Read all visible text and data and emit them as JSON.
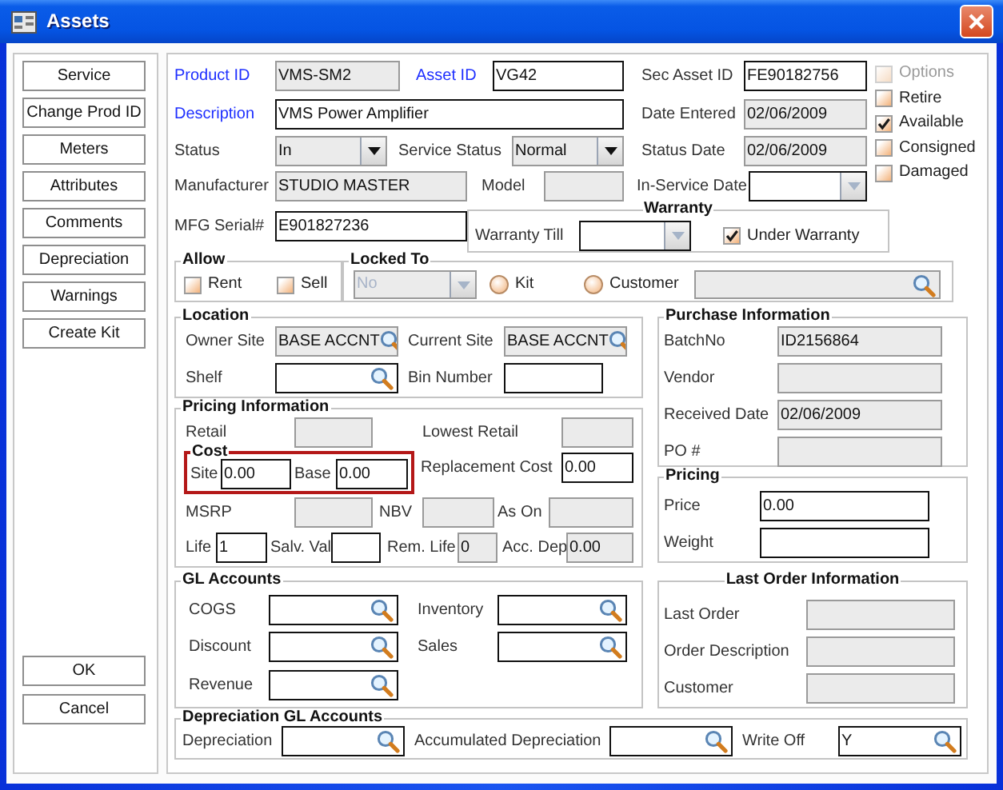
{
  "window": {
    "title": "Assets"
  },
  "side_buttons": [
    "Service",
    "Change Prod ID",
    "Meters",
    "Attributes",
    "Comments",
    "Depreciation",
    "Warnings",
    "Create Kit"
  ],
  "dialog_buttons": [
    "OK",
    "Cancel"
  ],
  "header": {
    "fields": [
      {
        "label": "Product ID",
        "link": true,
        "kind": "readonly",
        "value": "VMS-SM2"
      },
      {
        "label": "Asset ID",
        "link": true,
        "kind": "input",
        "value": "VG42"
      },
      {
        "label": "Sec Asset ID",
        "link": false,
        "kind": "input",
        "value": "FE90182756"
      },
      {
        "label": "Description",
        "link": true,
        "kind": "input",
        "value": "VMS Power Amplifier"
      },
      {
        "label": "Date Entered",
        "link": false,
        "kind": "readonly",
        "value": "02/06/2009"
      },
      {
        "label": "Status",
        "link": false,
        "kind": "combo",
        "value": "In"
      },
      {
        "label": "Service Status",
        "link": false,
        "kind": "combo",
        "value": "Normal"
      },
      {
        "label": "Status Date",
        "link": false,
        "kind": "readonly",
        "value": "02/06/2009"
      },
      {
        "label": "Manufacturer",
        "link": false,
        "kind": "readonly",
        "value": "STUDIO MASTER"
      },
      {
        "label": "Model",
        "link": false,
        "kind": "readonly"
      },
      {
        "label": "In-Service Date",
        "link": false,
        "kind": "date-picker"
      },
      {
        "label": "MFG Serial#",
        "link": false,
        "kind": "input",
        "value": "E901827236"
      }
    ],
    "options": [
      {
        "label": "Options",
        "checked": false,
        "disabled": true
      },
      {
        "label": "Retire",
        "checked": false,
        "disabled": false
      },
      {
        "label": "Available",
        "checked": true,
        "disabled": false
      },
      {
        "label": "Consigned",
        "checked": false,
        "disabled": false
      },
      {
        "label": "Damaged",
        "checked": false,
        "disabled": false
      }
    ]
  },
  "warranty": {
    "title": "Warranty",
    "till": {
      "label": "Warranty Till",
      "kind": "date-picker"
    },
    "under_warranty": {
      "label": "Under Warranty",
      "checked": true
    }
  },
  "allow": {
    "title": "Allow",
    "options": [
      {
        "label": "Rent",
        "checked": false
      },
      {
        "label": "Sell",
        "checked": false
      }
    ]
  },
  "locked_to": {
    "title": "Locked To",
    "combo": {
      "kind": "disabled-combo",
      "value": "No"
    },
    "choices": [
      {
        "label": "Kit",
        "selected": false
      },
      {
        "label": "Customer",
        "selected": false
      }
    ],
    "lookup": {
      "kind": "readonly-lookup"
    }
  },
  "location": {
    "title": "Location",
    "fields": [
      {
        "label": "Owner Site",
        "kind": "readonly-lookup",
        "value": "BASE ACCNT"
      },
      {
        "label": "Current Site",
        "kind": "readonly-lookup",
        "value": "BASE ACCNT"
      },
      {
        "label": "Shelf",
        "kind": "lookup"
      },
      {
        "label": "Bin Number",
        "kind": "input"
      }
    ]
  },
  "purchase_information": {
    "title": "Purchase Information",
    "fields": [
      {
        "label": "BatchNo",
        "kind": "readonly",
        "value": "ID2156864"
      },
      {
        "label": "Vendor",
        "kind": "readonly"
      },
      {
        "label": "Received Date",
        "kind": "readonly",
        "value": "02/06/2009"
      },
      {
        "label": "PO #",
        "kind": "readonly"
      }
    ]
  },
  "pricing_information": {
    "title": "Pricing Information",
    "fields": [
      {
        "label": "Retail",
        "kind": "readonly"
      },
      {
        "label": "Lowest Retail",
        "kind": "readonly"
      },
      {
        "label": "Replacement Cost",
        "kind": "input",
        "value": "0.00"
      },
      {
        "label": "MSRP",
        "kind": "readonly"
      },
      {
        "label": "NBV",
        "kind": "readonly"
      },
      {
        "label": "As On",
        "kind": "readonly"
      },
      {
        "label": "Life",
        "kind": "input",
        "value": "1"
      },
      {
        "label": "Salv. Val",
        "kind": "input"
      },
      {
        "label": "Rem. Life",
        "kind": "readonly",
        "value": "0"
      },
      {
        "label": "Acc. Dep",
        "kind": "readonly",
        "value": "0.00"
      }
    ],
    "cost": {
      "title": "Cost",
      "highlighted": true,
      "fields": [
        {
          "label": "Site",
          "kind": "input",
          "value": "0.00"
        },
        {
          "label": "Base",
          "kind": "input",
          "value": "0.00"
        }
      ]
    }
  },
  "pricing": {
    "title": "Pricing",
    "fields": [
      {
        "label": "Price",
        "kind": "input",
        "value": "0.00"
      },
      {
        "label": "Weight",
        "kind": "input"
      }
    ]
  },
  "gl_accounts": {
    "title": "GL Accounts",
    "fields": [
      {
        "label": "COGS",
        "kind": "lookup"
      },
      {
        "label": "Inventory",
        "kind": "lookup"
      },
      {
        "label": "Discount",
        "kind": "lookup"
      },
      {
        "label": "Sales",
        "kind": "lookup"
      },
      {
        "label": "Revenue",
        "kind": "lookup"
      }
    ]
  },
  "last_order_information": {
    "title": "Last Order Information",
    "fields": [
      {
        "label": "Last Order",
        "kind": "readonly"
      },
      {
        "label": "Order Description",
        "kind": "readonly"
      },
      {
        "label": "Customer",
        "kind": "readonly"
      }
    ]
  },
  "depreciation_gl_accounts": {
    "title": "Depreciation GL Accounts",
    "fields": [
      {
        "label": "Depreciation",
        "kind": "lookup"
      },
      {
        "label": "Accumulated Depreciation",
        "kind": "lookup"
      },
      {
        "label": "Write Off",
        "kind": "lookup",
        "value": "Y"
      }
    ]
  }
}
